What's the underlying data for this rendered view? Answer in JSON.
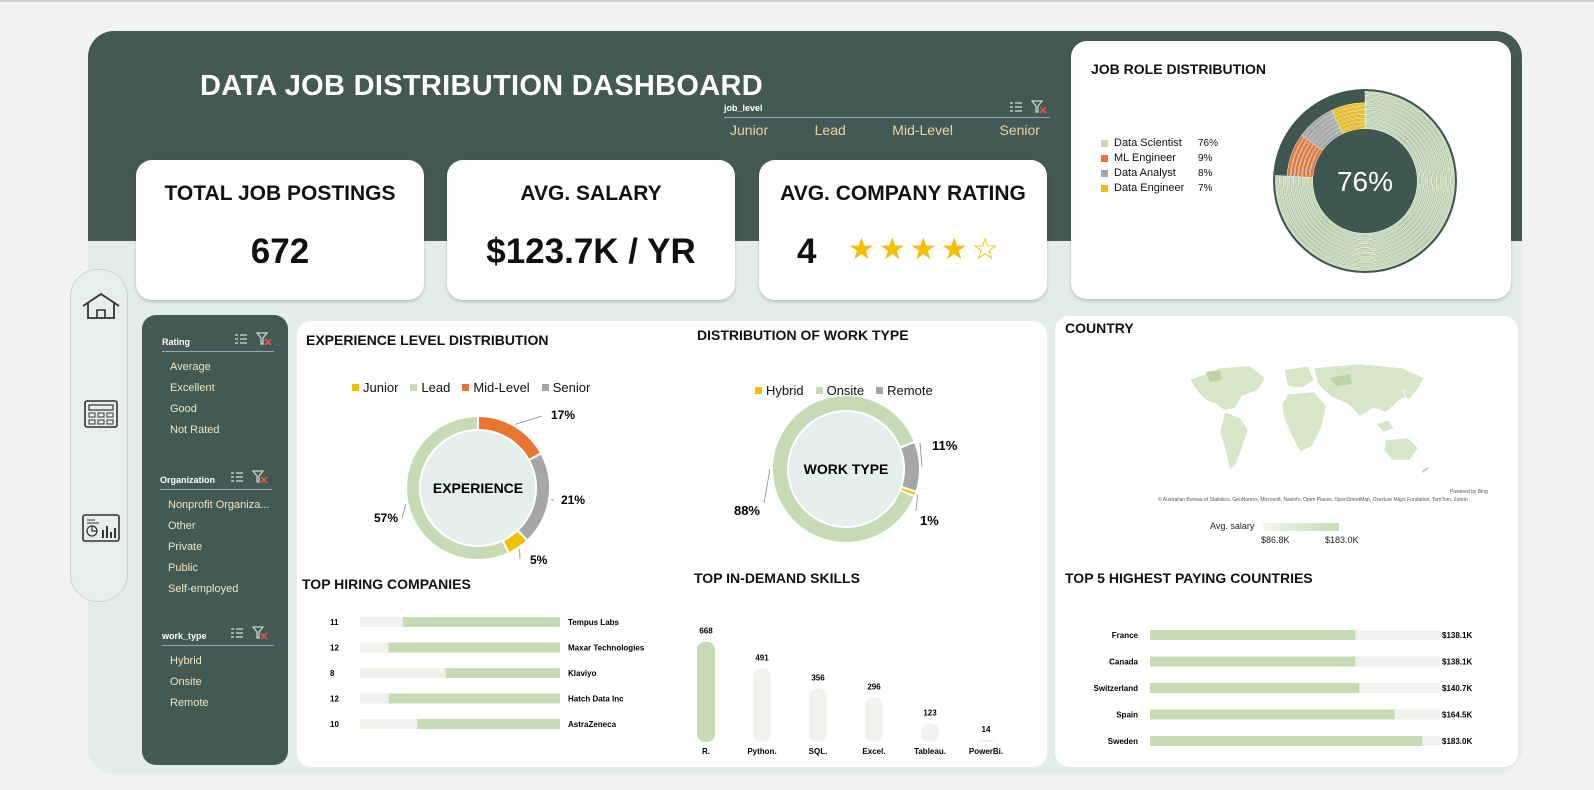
{
  "title": "DATA JOB DISTRIBUTION DASHBOARD",
  "job_level_slicer": {
    "header": "job_level",
    "items": [
      "Junior",
      "Lead",
      "Mid-Level",
      "Senior"
    ]
  },
  "kpis": {
    "total_postings": {
      "label": "TOTAL JOB POSTINGS",
      "value": "672"
    },
    "avg_salary": {
      "label": "AVG. SALARY",
      "value": "$123.7K / YR"
    },
    "avg_rating": {
      "label": "AVG. COMPANY RATING",
      "value": "4",
      "stars_filled": 4,
      "stars_total": 5
    }
  },
  "filters": {
    "rating": {
      "header": "Rating",
      "items": [
        "Average",
        "Excellent",
        "Good",
        "Not Rated"
      ]
    },
    "organization": {
      "header": "Organization",
      "items": [
        "Nonprofit Organiza...",
        "Other",
        "Private",
        "Public",
        "Self-employed"
      ]
    },
    "work_type": {
      "header": "work_type",
      "items": [
        "Hybrid",
        "Onsite",
        "Remote"
      ]
    }
  },
  "nav": {
    "icons": [
      "home-icon",
      "calculator-icon",
      "dashboard-icon"
    ]
  },
  "colors": {
    "dark_green": "#425a53",
    "light_green": "#c5dbb3",
    "orange": "#e87532",
    "gray": "#a6a6a6",
    "yellow": "#f6be00",
    "track": "#f1f2ec"
  },
  "chart_data": [
    {
      "type": "pie",
      "title": "JOB ROLE DISTRIBUTION",
      "center_label": "76%",
      "categories": [
        "Data Scientist",
        "ML Engineer",
        "Data Analyst",
        "Data Engineer"
      ],
      "values": [
        76,
        9,
        8,
        7
      ],
      "value_labels": [
        "76%",
        "9%",
        "8%",
        "7%"
      ],
      "colors": [
        "#c5dbb3",
        "#e87532",
        "#a6a6a6",
        "#f6be00"
      ],
      "legend": "left"
    },
    {
      "type": "pie",
      "title": "EXPERIENCE LEVEL DISTRIBUTION",
      "center_label": "EXPERIENCE",
      "categories": [
        "Junior",
        "Lead",
        "Mid-Level",
        "Senior"
      ],
      "values": [
        5,
        57,
        17,
        21
      ],
      "value_labels": [
        "5%",
        "57%",
        "17%",
        "21%"
      ],
      "colors": [
        "#f6be00",
        "#c5dbb3",
        "#e87532",
        "#a6a6a6"
      ],
      "legend": "top"
    },
    {
      "type": "pie",
      "title": "DISTRIBUTION OF WORK TYPE",
      "center_label": "WORK TYPE",
      "categories": [
        "Hybrid",
        "Onsite",
        "Remote"
      ],
      "values": [
        1,
        88,
        11
      ],
      "value_labels": [
        "1%",
        "88%",
        "11%"
      ],
      "colors": [
        "#f6be00",
        "#c5dbb3",
        "#a6a6a6"
      ],
      "legend": "top"
    },
    {
      "type": "heatmap",
      "title": "COUNTRY",
      "attribution_top": "Powered by Bing",
      "attribution": "© Australian Bureau of Statistics, GeoNames, Microsoft, Navinfo, Open Places, OpenStreetMap, Overture Maps Fundation, TomTom, Zenrin",
      "legend_title": "Avg. salary",
      "range_labels": [
        "$86.8K",
        "$183.0K"
      ]
    },
    {
      "type": "bar",
      "title": "TOP HIRING COMPANIES",
      "orientation": "horizontal",
      "categories": [
        "Tempus Labs",
        "Maxar Technologies",
        "Klaviyo",
        "Hatch Data Inc",
        "AstraZeneca"
      ],
      "values": [
        11,
        12,
        8,
        12,
        10
      ],
      "xlim": [
        0,
        14
      ]
    },
    {
      "type": "bar",
      "title": "TOP IN-DEMAND SKILLS",
      "orientation": "vertical",
      "categories": [
        "R.",
        "Python.",
        "SQL.",
        "Excel.",
        "Tableau.",
        "PowerBi."
      ],
      "values": [
        668,
        491,
        356,
        296,
        123,
        14
      ],
      "ylim": [
        0,
        700
      ]
    },
    {
      "type": "bar",
      "title": "TOP 5 HIGHEST PAYING COUNTRIES",
      "orientation": "horizontal",
      "categories": [
        "France",
        "Canada",
        "Switzerland",
        "Spain",
        "Sweden"
      ],
      "values": [
        138.1,
        138.1,
        140.7,
        164.5,
        183.0
      ],
      "value_labels": [
        "$138.1K",
        "$138.1K",
        "$140.7K",
        "$164.5K",
        "$183.0K"
      ],
      "xlim": [
        0,
        195
      ]
    }
  ]
}
